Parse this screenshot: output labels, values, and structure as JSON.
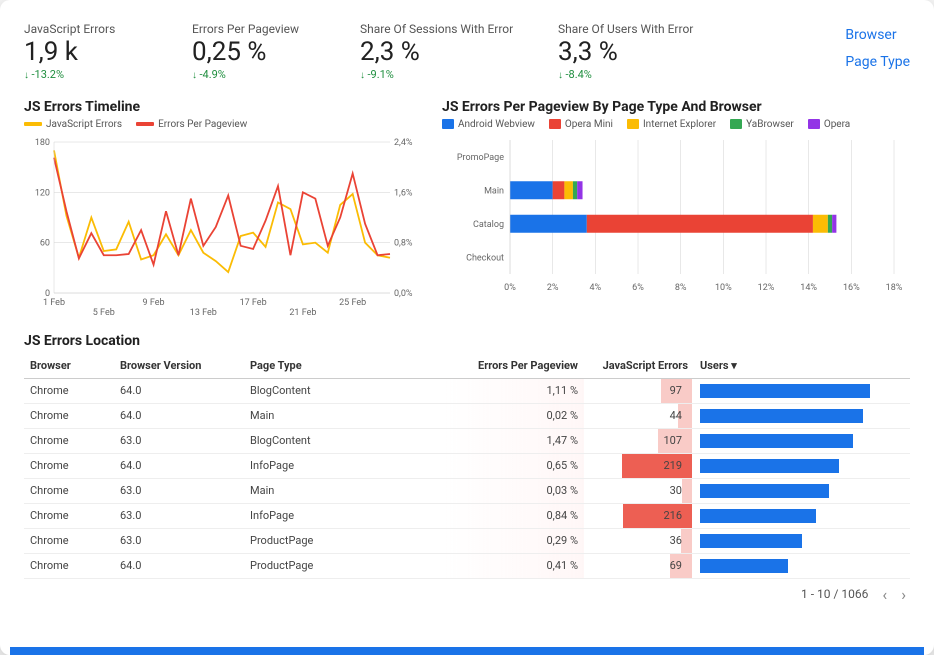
{
  "kpis": [
    {
      "label": "JavaScript Errors",
      "value": "1,9 k",
      "delta": "-13.2%"
    },
    {
      "label": "Errors Per Pageview",
      "value": "0,25 %",
      "delta": "-4.9%"
    },
    {
      "label": "Share Of Sessions With Error",
      "value": "2,3 %",
      "delta": "-9.1%"
    },
    {
      "label": "Share Of Users With Error",
      "value": "3,3 %",
      "delta": "-8.4%"
    }
  ],
  "links": {
    "browser": "Browser",
    "pageType": "Page Type"
  },
  "timeline": {
    "title": "JS Errors Timeline",
    "legend": [
      {
        "name": "JavaScript Errors",
        "color": "#fbbc04"
      },
      {
        "name": "Errors Per Pageview",
        "color": "#ea4335"
      }
    ]
  },
  "byPageType": {
    "title": "JS Errors Per Pageview By Page Type And Browser",
    "legend": [
      {
        "name": "Android Webview",
        "color": "#1a73e8"
      },
      {
        "name": "Opera Mini",
        "color": "#ea4335"
      },
      {
        "name": "Internet Explorer",
        "color": "#fbbc04"
      },
      {
        "name": "YaBrowser",
        "color": "#34a853"
      },
      {
        "name": "Opera",
        "color": "#9334e6"
      }
    ]
  },
  "locationTitle": "JS Errors Location",
  "table": {
    "headers": {
      "browser": "Browser",
      "version": "Browser Version",
      "pageType": "Page Type",
      "epp": "Errors Per Pageview",
      "jserr": "JavaScript Errors",
      "users": "Users"
    },
    "rows": [
      {
        "browser": "Chrome",
        "version": "64.0",
        "pageType": "BlogContent",
        "epp": "1,11 %",
        "jserr": 97,
        "usersPct": 100
      },
      {
        "browser": "Chrome",
        "version": "64.0",
        "pageType": "Main",
        "epp": "0,02 %",
        "jserr": 44,
        "usersPct": 96
      },
      {
        "browser": "Chrome",
        "version": "63.0",
        "pageType": "BlogContent",
        "epp": "1,47 %",
        "jserr": 107,
        "usersPct": 90
      },
      {
        "browser": "Chrome",
        "version": "64.0",
        "pageType": "InfoPage",
        "epp": "0,65 %",
        "jserr": 219,
        "usersPct": 82
      },
      {
        "browser": "Chrome",
        "version": "63.0",
        "pageType": "Main",
        "epp": "0,03 %",
        "jserr": 30,
        "usersPct": 76
      },
      {
        "browser": "Chrome",
        "version": "63.0",
        "pageType": "InfoPage",
        "epp": "0,84 %",
        "jserr": 216,
        "usersPct": 68
      },
      {
        "browser": "Chrome",
        "version": "63.0",
        "pageType": "ProductPage",
        "epp": "0,29 %",
        "jserr": 36,
        "usersPct": 60
      },
      {
        "browser": "Chrome",
        "version": "64.0",
        "pageType": "ProductPage",
        "epp": "0,41 %",
        "jserr": 69,
        "usersPct": 52
      }
    ],
    "pager": "1 - 10 / 1066"
  },
  "chart_data": [
    {
      "type": "line",
      "title": "JS Errors Timeline",
      "x_ticks": [
        "1 Feb",
        "5 Feb",
        "9 Feb",
        "13 Feb",
        "17 Feb",
        "21 Feb",
        "25 Feb"
      ],
      "y_left": {
        "label": "JavaScript Errors",
        "range": [
          0,
          180
        ],
        "ticks": [
          0,
          60,
          120,
          180
        ]
      },
      "y_right": {
        "label": "Errors Per Pageview (%)",
        "range": [
          0,
          2.4
        ],
        "ticks": [
          0,
          0.8,
          1.6,
          2.4
        ]
      },
      "series": [
        {
          "name": "JavaScript Errors",
          "axis": "left",
          "color": "#fbbc04",
          "values": [
            170,
            92,
            42,
            90,
            50,
            52,
            85,
            40,
            45,
            70,
            45,
            75,
            48,
            38,
            25,
            68,
            72,
            55,
            108,
            100,
            58,
            60,
            48,
            105,
            118,
            60,
            45,
            42
          ]
        },
        {
          "name": "Errors Per Pageview",
          "axis": "right",
          "color": "#ea4335",
          "values": [
            2.15,
            1.3,
            0.55,
            0.95,
            0.6,
            0.6,
            0.62,
            1.0,
            0.45,
            1.3,
            0.6,
            1.5,
            0.75,
            1.05,
            1.55,
            0.75,
            0.7,
            1.15,
            1.7,
            0.6,
            1.6,
            1.5,
            0.75,
            1.2,
            1.9,
            1.1,
            0.6,
            0.62
          ]
        }
      ]
    },
    {
      "type": "bar",
      "orientation": "horizontal",
      "stacked": true,
      "title": "JS Errors Per Pageview By Page Type And Browser",
      "xlabel": "%",
      "xlim": [
        0,
        18
      ],
      "x_ticks": [
        0,
        2,
        4,
        6,
        8,
        10,
        12,
        14,
        16,
        18
      ],
      "categories": [
        "PromoPage",
        "Main",
        "Catalog",
        "Checkout"
      ],
      "series": [
        {
          "name": "Android Webview",
          "color": "#1a73e8",
          "values": [
            0.0,
            2.0,
            3.6,
            0.0
          ]
        },
        {
          "name": "Opera Mini",
          "color": "#ea4335",
          "values": [
            0.0,
            0.55,
            10.6,
            0.0
          ]
        },
        {
          "name": "Internet Explorer",
          "color": "#fbbc04",
          "values": [
            0.0,
            0.4,
            0.7,
            0.0
          ]
        },
        {
          "name": "YaBrowser",
          "color": "#34a853",
          "values": [
            0.0,
            0.2,
            0.2,
            0.0
          ]
        },
        {
          "name": "Opera",
          "color": "#9334e6",
          "values": [
            0.0,
            0.25,
            0.2,
            0.0
          ]
        }
      ]
    }
  ]
}
